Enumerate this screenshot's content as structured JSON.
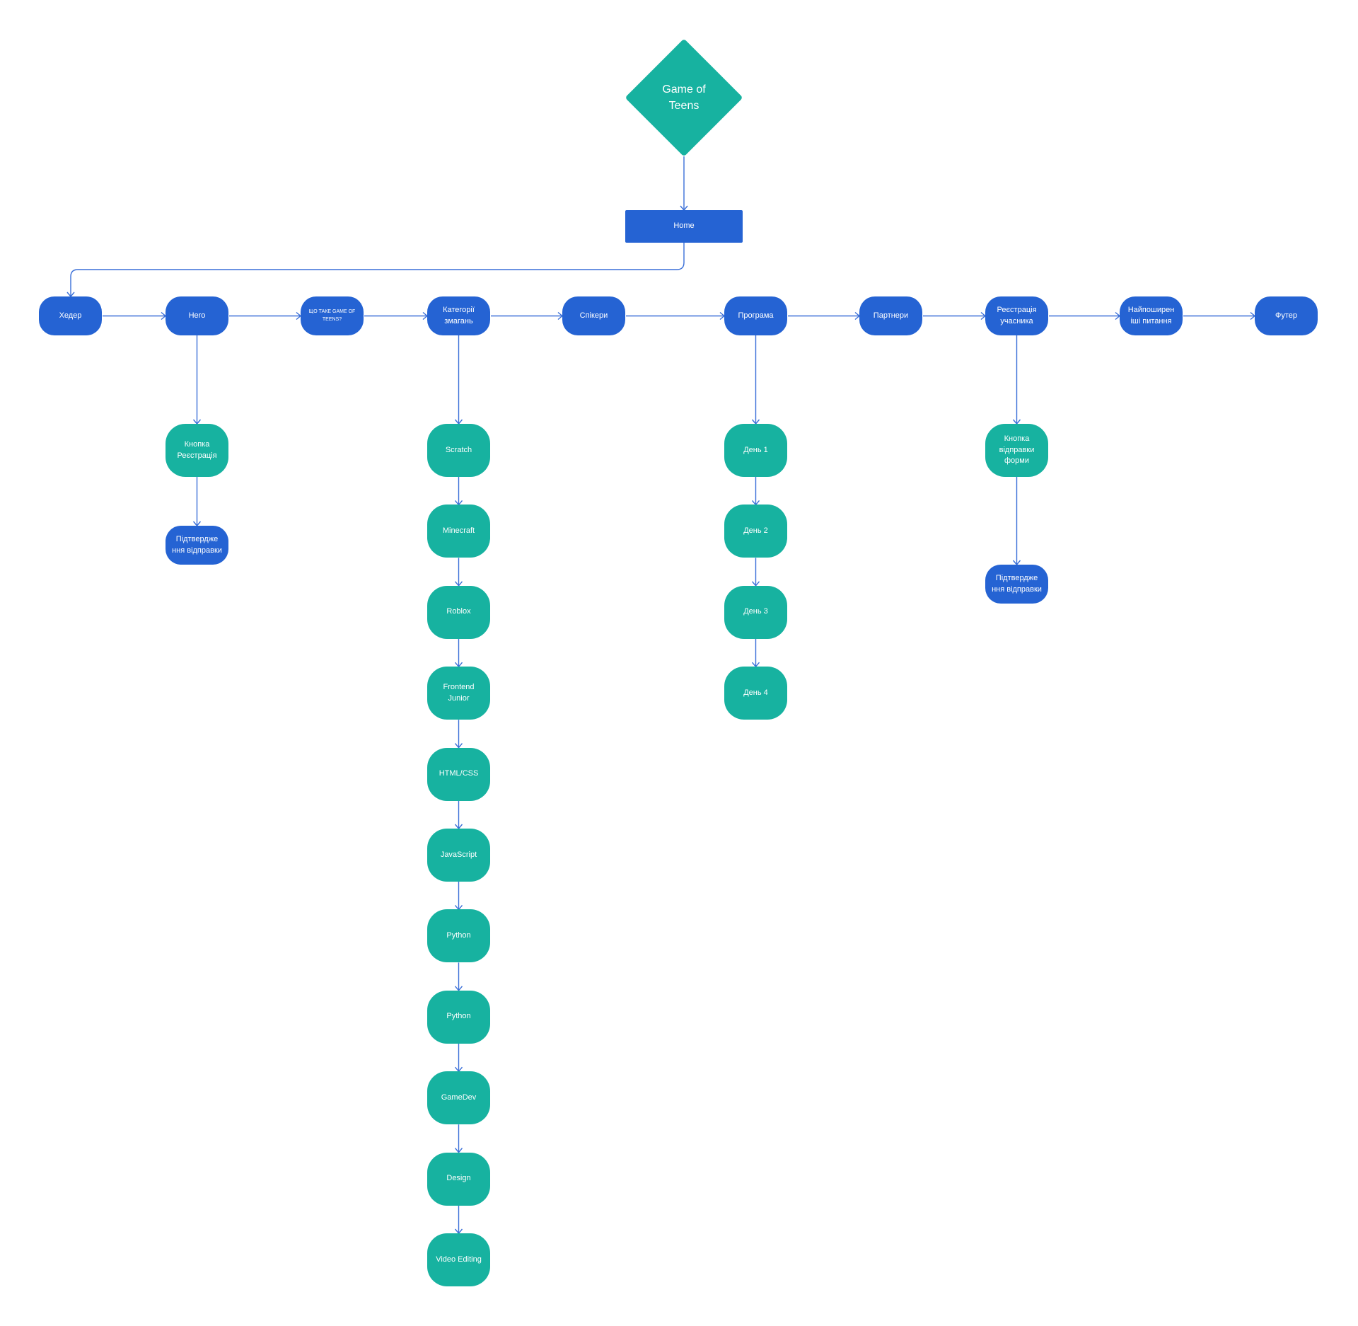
{
  "diagram": {
    "title": "Game of Teens sitemap",
    "colors": {
      "section": "#2563d3",
      "item": "#17b2a0",
      "connector": "#3a6fd8",
      "background": "#ffffff"
    },
    "root": {
      "label_line1": "Game of",
      "label_line2": "Teens",
      "shape": "diamond"
    },
    "home": {
      "label": "Home",
      "shape": "rectangle"
    },
    "sections": [
      {
        "id": "header",
        "lines": [
          "Хедер"
        ]
      },
      {
        "id": "hero",
        "lines": [
          "Hero"
        ]
      },
      {
        "id": "about",
        "lines": [
          "ЩО ТАКЕ GAME OF",
          "TEENS?"
        ]
      },
      {
        "id": "categories",
        "lines": [
          "Категорії",
          "змагань"
        ]
      },
      {
        "id": "speakers",
        "lines": [
          "Спікери"
        ]
      },
      {
        "id": "program",
        "lines": [
          "Програма"
        ]
      },
      {
        "id": "partners",
        "lines": [
          "Партнери"
        ]
      },
      {
        "id": "registration",
        "lines": [
          "Реєстрація",
          "учасника"
        ]
      },
      {
        "id": "faq",
        "lines": [
          "Найпоширен",
          "іші питання"
        ]
      },
      {
        "id": "footer",
        "lines": [
          "Футер"
        ]
      }
    ],
    "hero_children": [
      {
        "id": "hero-register-button",
        "lines": [
          "Кнопка",
          "Реєстрація"
        ],
        "kind": "item"
      },
      {
        "id": "hero-confirmation",
        "lines": [
          "Підтвердже",
          "ння відправки"
        ],
        "kind": "section"
      }
    ],
    "categories_children": [
      "Scratch",
      "Minecraft",
      "Roblox",
      "Frontend Junior",
      "HTML/CSS",
      "JavaScript",
      "Python",
      "Python",
      "GameDev",
      "Design",
      "Video Editing"
    ],
    "program_children": [
      "День 1",
      "День 2",
      "День 3",
      "День 4"
    ],
    "registration_children": [
      {
        "id": "form-submit-button",
        "lines": [
          "Кнопка",
          "відправки",
          "форми"
        ],
        "kind": "item"
      },
      {
        "id": "registration-confirmation",
        "lines": [
          "Підтвердже",
          "ння відправки"
        ],
        "kind": "section"
      }
    ]
  }
}
